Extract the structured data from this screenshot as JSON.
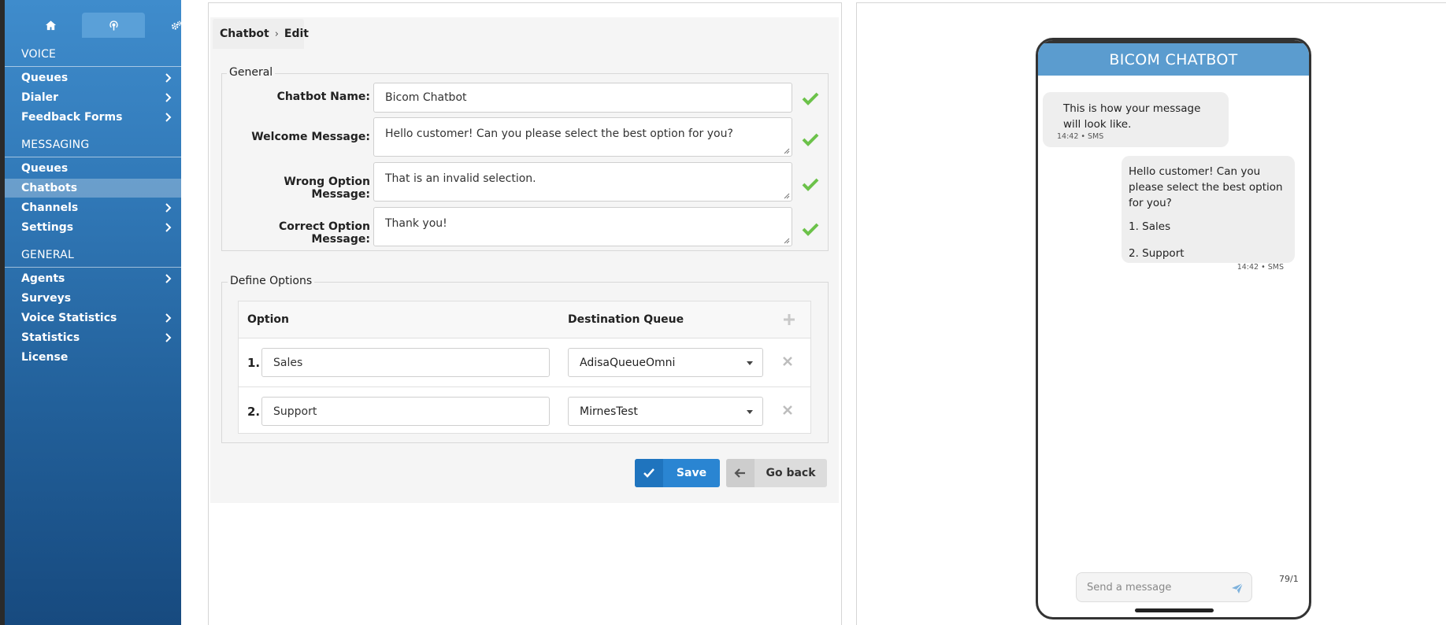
{
  "sidebar": {
    "tabs": [
      {
        "icon": "home-icon",
        "active": false
      },
      {
        "icon": "broadcast-icon",
        "active": true
      },
      {
        "icon": "gears-icon",
        "active": false
      }
    ],
    "sections": [
      {
        "title": "VOICE",
        "items": [
          {
            "label": "Queues",
            "has_submenu": true
          },
          {
            "label": "Dialer",
            "has_submenu": true
          },
          {
            "label": "Feedback Forms",
            "has_submenu": true
          }
        ]
      },
      {
        "title": "MESSAGING",
        "items": [
          {
            "label": "Queues",
            "has_submenu": false
          },
          {
            "label": "Chatbots",
            "has_submenu": false,
            "active": true
          },
          {
            "label": "Channels",
            "has_submenu": true
          },
          {
            "label": "Settings",
            "has_submenu": true
          }
        ]
      },
      {
        "title": "GENERAL",
        "items": [
          {
            "label": "Agents",
            "has_submenu": true
          },
          {
            "label": "Surveys",
            "has_submenu": false
          },
          {
            "label": "Voice Statistics",
            "has_submenu": true
          },
          {
            "label": "Statistics",
            "has_submenu": true
          },
          {
            "label": "License",
            "has_submenu": false
          }
        ]
      }
    ]
  },
  "breadcrumb": {
    "parent": "Chatbot",
    "current": "Edit"
  },
  "general": {
    "legend": "General",
    "chatbot_name_label": "Chatbot Name:",
    "chatbot_name_value": "Bicom Chatbot",
    "welcome_label": "Welcome Message:",
    "welcome_value": "Hello customer! Can you please select the best option for you?",
    "wrong_label": "Wrong Option Message:",
    "wrong_value": "That is an invalid selection.",
    "correct_label": "Correct Option Message:",
    "correct_value": "Thank you!"
  },
  "options": {
    "legend": "Define Options",
    "col_option": "Option",
    "col_queue": "Destination Queue",
    "rows": [
      {
        "num": "1.",
        "option": "Sales",
        "queue": "AdisaQueueOmni"
      },
      {
        "num": "2.",
        "option": "Support",
        "queue": "MirnesTest"
      }
    ]
  },
  "buttons": {
    "save": "Save",
    "back": "Go back"
  },
  "preview": {
    "header": "BICOM CHATBOT",
    "incoming_text": "This is how your message will look like.",
    "incoming_meta": "14:42 • SMS",
    "outgoing_text": "Hello customer! Can you please select the best option for you?",
    "outgoing_option_1": "1. Sales",
    "outgoing_option_2": "2. Support",
    "outgoing_meta": "14:42 • SMS",
    "input_placeholder": "Send a message",
    "counter": "79/1"
  },
  "colors": {
    "sidebar": "#3179b8",
    "accent": "#2a85d2",
    "check": "#6cc24a",
    "phone_header": "#5b9ccf"
  }
}
